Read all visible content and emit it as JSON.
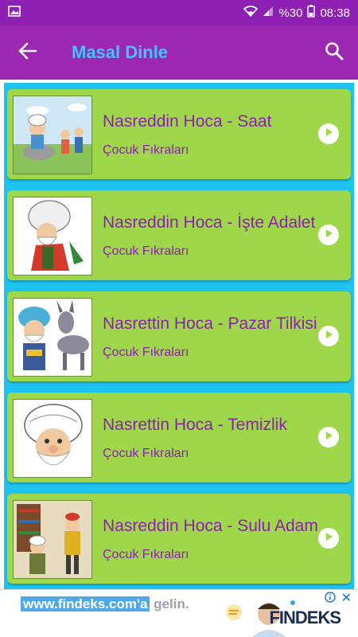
{
  "status_bar": {
    "gallery_icon": "image-icon",
    "wifi_icon": "wifi-icon",
    "signal_icon": "signal-icon",
    "battery_text": "%30",
    "battery_icon": "battery-icon",
    "time": "08:38"
  },
  "app_bar": {
    "back_icon": "arrow-left-icon",
    "title": "Masal Dinle",
    "search_icon": "search-icon",
    "background": "#9c27b0",
    "title_color": "#40c4ff"
  },
  "list": {
    "background": "#1ec3f0",
    "card_color": "#9ed84a",
    "text_color": "#8e1fb3",
    "items": [
      {
        "title": "Nasreddin Hoca - Saat",
        "subtitle": "Çocuk Fıkraları",
        "play_icon": "play-icon"
      },
      {
        "title": "Nasreddin Hoca - İşte Adalet",
        "subtitle": "Çocuk Fıkraları",
        "play_icon": "play-icon"
      },
      {
        "title": "Nasrettin Hoca - Pazar Tilkisi",
        "subtitle": "Çocuk Fıkraları",
        "play_icon": "play-icon"
      },
      {
        "title": "Nasrettin Hoca - Temizlik",
        "subtitle": "Çocuk Fıkraları",
        "play_icon": "play-icon"
      },
      {
        "title": "Nasreddin Hoca - Sulu Adam",
        "subtitle": "Çocuk Fıkraları",
        "play_icon": "play-icon"
      }
    ]
  },
  "ad": {
    "highlight_text": "www.findeks.com'a",
    "rest_text": " gelin.",
    "brand": "FINDEKS",
    "info_icon": "info-icon",
    "close_icon": "close-icon"
  }
}
